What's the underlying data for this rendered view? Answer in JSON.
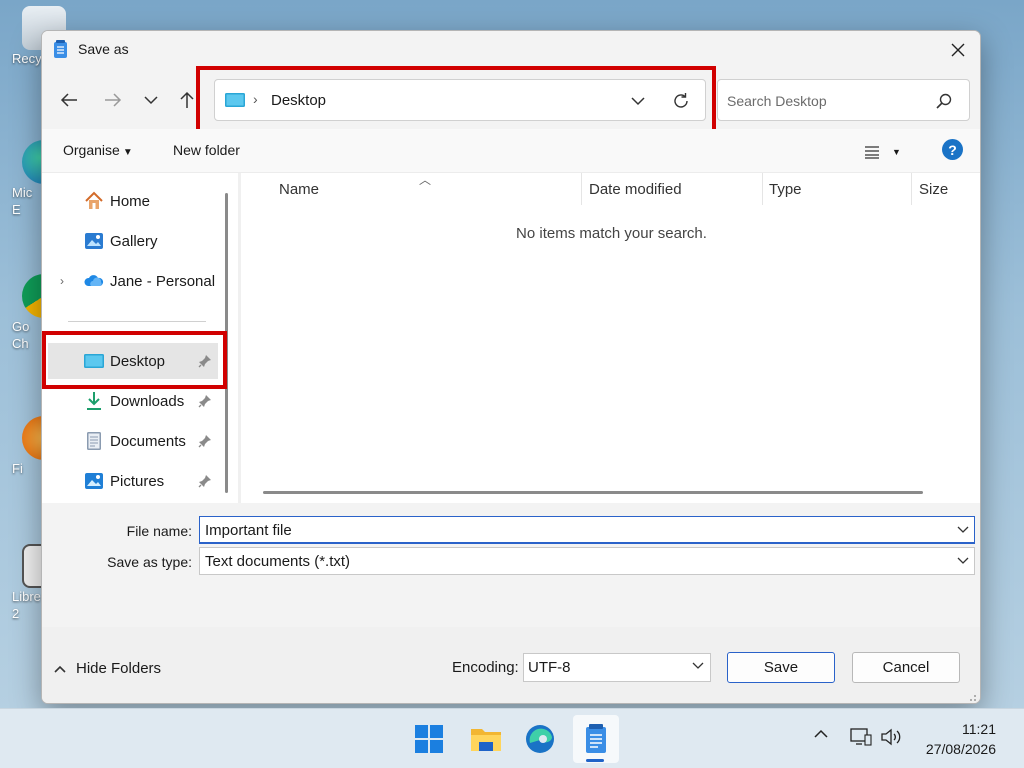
{
  "desktop": {
    "icons": [
      {
        "label": "Recy",
        "icon": "recycle-bin-icon"
      },
      {
        "label": "Mic\nE",
        "icon": "edge-shortcut-icon"
      },
      {
        "label": "Go\nCh",
        "icon": "chrome-shortcut-icon"
      },
      {
        "label": "Fi",
        "icon": "firefox-shortcut-icon"
      },
      {
        "label": "Libre\n2",
        "icon": "libreoffice-shortcut-icon"
      }
    ]
  },
  "dialog": {
    "title": "Save as",
    "address": {
      "crumb": "Desktop",
      "separator": "›"
    },
    "search": {
      "placeholder": "Search Desktop"
    },
    "toolbar": {
      "organise": "Organise",
      "new_folder": "New folder",
      "help": "?"
    },
    "nav": {
      "items": [
        {
          "label": "Home",
          "icon": "home-icon"
        },
        {
          "label": "Gallery",
          "icon": "gallery-icon"
        },
        {
          "label": "Jane - Personal",
          "icon": "onedrive-icon"
        },
        {
          "label": "Desktop",
          "icon": "desktop-folder-icon",
          "selected": true
        },
        {
          "label": "Downloads",
          "icon": "downloads-icon"
        },
        {
          "label": "Documents",
          "icon": "documents-icon"
        },
        {
          "label": "Pictures",
          "icon": "pictures-icon"
        }
      ]
    },
    "columns": [
      "Name",
      "Date modified",
      "Type",
      "Size"
    ],
    "empty_message": "No items match your search.",
    "file_name": {
      "label": "File name:",
      "value": "Important file"
    },
    "save_as_type": {
      "label": "Save as type:",
      "value": "Text documents (*.txt)"
    },
    "footer": {
      "hide_folders": "Hide Folders",
      "encoding_label": "Encoding:",
      "encoding_value": "UTF-8",
      "save": "Save",
      "cancel": "Cancel"
    }
  },
  "taskbar": {
    "apps": [
      "start-icon",
      "file-explorer-icon",
      "edge-icon",
      "notepad-icon"
    ],
    "time": "11:21",
    "date": "27/08/2026"
  },
  "colors": {
    "highlight": "#d10000",
    "accent": "#1f63c8"
  }
}
